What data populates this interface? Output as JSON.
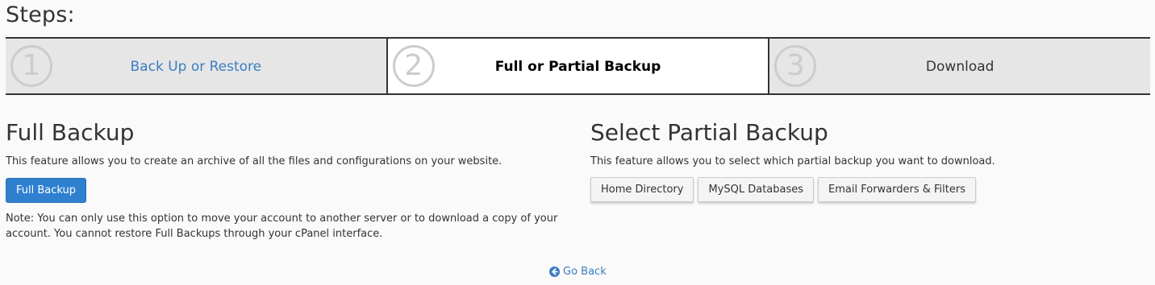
{
  "page": {
    "steps_title": "Steps:"
  },
  "steps": [
    {
      "number": "1",
      "label": "Back Up or Restore",
      "state": "link"
    },
    {
      "number": "2",
      "label": "Full or Partial Backup",
      "state": "current"
    },
    {
      "number": "3",
      "label": "Download",
      "state": "upcoming"
    }
  ],
  "full_backup": {
    "title": "Full Backup",
    "description": "This feature allows you to create an archive of all the files and configurations on your website.",
    "button_label": "Full Backup",
    "note": "Note: You can only use this option to move your account to another server or to download a copy of your account. You cannot restore Full Backups through your cPanel interface."
  },
  "partial_backup": {
    "title": "Select Partial Backup",
    "description": "This feature allows you to select which partial backup you want to download.",
    "buttons": [
      {
        "label": "Home Directory"
      },
      {
        "label": "MySQL Databases"
      },
      {
        "label": "Email Forwarders & Filters"
      }
    ]
  },
  "footer": {
    "go_back_label": "Go Back",
    "go_back_icon": "arrow-circle-left-icon"
  },
  "colors": {
    "link": "#3a7dc1",
    "primary_button": "#2f80cf",
    "active_step_bg": "#ffffff",
    "inactive_step_bg": "#e6e6e6"
  }
}
